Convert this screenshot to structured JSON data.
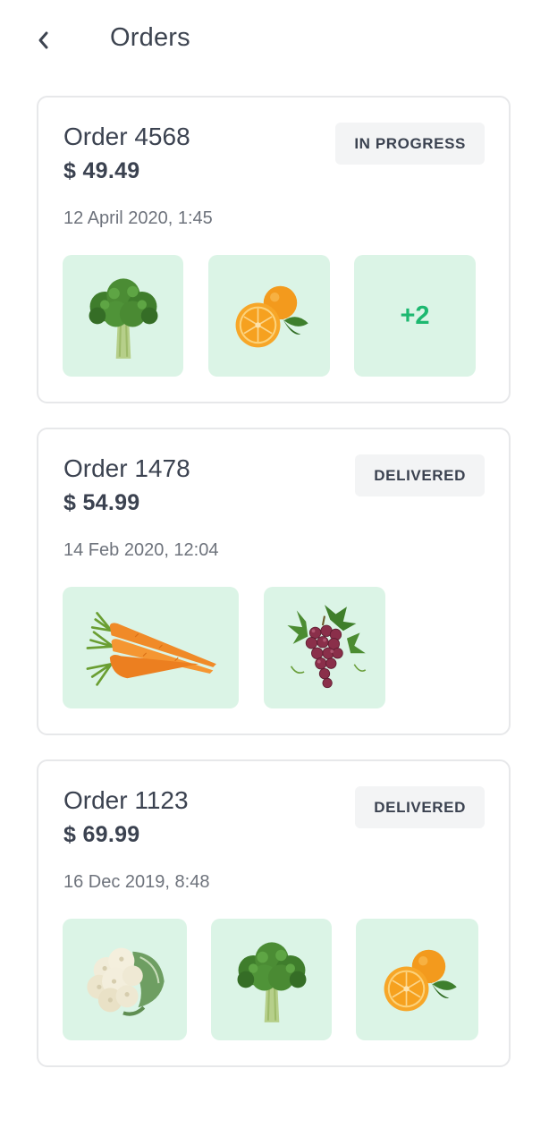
{
  "header": {
    "title": "Orders",
    "back_icon": "chevron-left-icon"
  },
  "colors": {
    "accent": "#1db870",
    "thumb_bg": "#dbf4e6",
    "badge_bg": "#f3f4f5",
    "text": "#3b4250",
    "muted": "#6e737c",
    "border": "#e7e8ea"
  },
  "orders": [
    {
      "title": "Order 4568",
      "price": "$ 49.49",
      "date": "12 April 2020, 1:45",
      "status": "IN PROGRESS",
      "items": [
        {
          "icon": "broccoli-icon"
        },
        {
          "icon": "orange-icon"
        },
        {
          "more": "+2"
        }
      ]
    },
    {
      "title": "Order 1478",
      "price": "$ 54.99",
      "date": "14 Feb 2020, 12:04",
      "status": "DELIVERED",
      "items": [
        {
          "icon": "carrots-icon"
        },
        {
          "icon": "grapes-icon"
        }
      ]
    },
    {
      "title": "Order 1123",
      "price": "$ 69.99",
      "date": "16 Dec 2019, 8:48",
      "status": "DELIVERED",
      "items": [
        {
          "icon": "cauliflower-icon"
        },
        {
          "icon": "broccoli-icon"
        },
        {
          "icon": "orange-icon"
        }
      ]
    }
  ]
}
